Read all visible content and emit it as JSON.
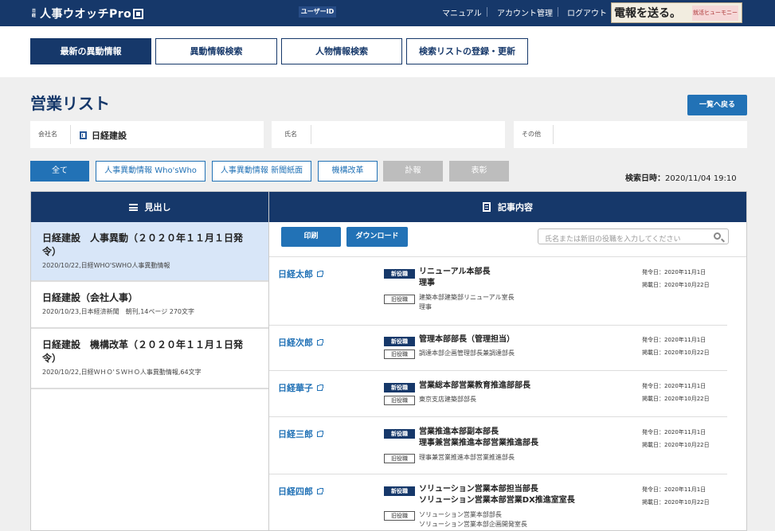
{
  "header": {
    "logo_tiny": "日経",
    "logo_text": "人事ウオッチPro",
    "user_id_label": "ユーザーID",
    "nav": [
      "マニュアル",
      "アカウント管理",
      "ログアウト"
    ],
    "banner_text": "電報を送る。",
    "banner_sub": "就活ヒューモニー"
  },
  "tabs": [
    "最新の異動情報",
    "異動情報検索",
    "人物情報検索",
    "検索リストの登録・更新"
  ],
  "page": {
    "title": "営業リスト",
    "back_label": "一覧へ戻る"
  },
  "filters": {
    "company_label": "会社名",
    "company_value": "日経建設",
    "name_label": "氏名",
    "name_value": "",
    "other_label": "その他",
    "other_value": ""
  },
  "categories": [
    {
      "label": "全て",
      "state": "active"
    },
    {
      "label": "人事異動情報 Who'sWho",
      "state": "normal"
    },
    {
      "label": "人事異動情報 新聞紙面",
      "state": "normal"
    },
    {
      "label": "機構改革",
      "state": "normal"
    },
    {
      "label": "訃報",
      "state": "disabled"
    },
    {
      "label": "表彰",
      "state": "disabled"
    }
  ],
  "search_time": {
    "label": "検索日時：",
    "value": "2020/11/04 19:10"
  },
  "left_panel": {
    "heading": "見出し",
    "items": [
      {
        "title": "日経建設　人事異動（２０２０年１１月１日発令）",
        "meta": "2020/10/22,日経WHO'SWHO人事異動情報"
      },
      {
        "title": "日経建設（会社人事）",
        "meta": "2020/10/23,日本経済新聞　朝刊,14ページ 270文字"
      },
      {
        "title": "日経建設　機構改革（２０２０年１１月１日発令）",
        "meta": "2020/10/22,日経ＷＨＯ'ＳＷＨＯ人事異動情報,64文字"
      }
    ]
  },
  "right_panel": {
    "heading": "記事内容",
    "print_label": "印刷",
    "download_label": "ダウンロード",
    "search_placeholder": "氏名または新旧の役職を入力してください",
    "badge_new": "新役職",
    "badge_old": "旧役職",
    "issue_label": "発令日：2020年11月1日",
    "post_label": "掲載日：2020年10月22日",
    "people": [
      {
        "name": "日経太郎",
        "new": [
          "リニューアル本部長",
          "理事"
        ],
        "old": [
          "建築本部建築部リニューアル室長",
          "理事"
        ]
      },
      {
        "name": "日経次郎",
        "new": [
          "管理本部部長（管理担当）"
        ],
        "old": [
          "調達本部企画管理部長兼調達部長"
        ]
      },
      {
        "name": "日経華子",
        "new": [
          "営業総本部営業教育推進部部長"
        ],
        "old": [
          "東京支店建築部部長"
        ]
      },
      {
        "name": "日経三郎",
        "new": [
          "営業推進本部副本部長",
          "理事兼営業推進本部営業推進部長"
        ],
        "old": [
          "理事兼営業推進本部営業推進部長"
        ]
      },
      {
        "name": "日経四郎",
        "new": [
          "ソリューション営業本部担当部長",
          "ソリューション営業本部営業DX推進室室長"
        ],
        "old": [
          "ソリューション営業本部部長",
          "ソリューション営業本部企画開発室長"
        ]
      }
    ]
  }
}
